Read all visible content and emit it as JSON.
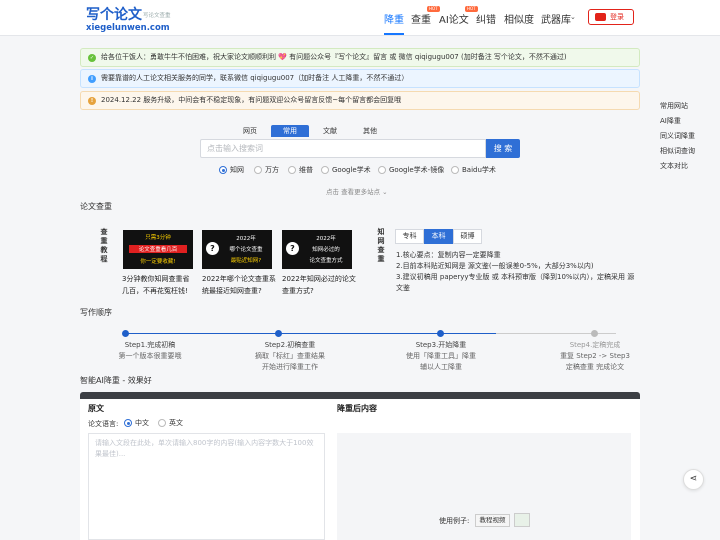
{
  "header": {
    "logo_main": "写个论文",
    "logo_sub": "写论文查重",
    "logo_domain": "xiegelunwen.com",
    "nav": [
      {
        "label": "降重",
        "active": true
      },
      {
        "label": "查重",
        "badge": "HOT"
      },
      {
        "label": "AI论文",
        "badge": "HOT"
      },
      {
        "label": "纠错"
      },
      {
        "label": "相似度"
      },
      {
        "label": "武器库"
      }
    ],
    "login_label": "登录"
  },
  "notices": [
    {
      "type": "success",
      "icon": "check-icon",
      "text": "给各位干饭人：勇敢牛牛不怕困难，祝大家论文顺顺利利 💖  有问题公众号『写个论文』留言 或 微信 qiqigugu007 (加时备注 写个论文，不然不通过)"
    },
    {
      "type": "info",
      "icon": "info-icon",
      "text": "需要靠谱的人工论文相关服务的同学，联系微信 qiqigugu007（加时备注 人工降重，不然不通过）"
    },
    {
      "type": "warning",
      "icon": "warning-icon",
      "text": "2024.12.22 服务升级，中间会有不稳定现象，有问题双迎公众号留言反馈~每个留言都会回复哦"
    }
  ],
  "right_links": [
    "常用网站",
    "AI降重",
    "同义词降重",
    "相似词查询",
    "文本对比"
  ],
  "search": {
    "tabs": [
      "网页",
      "常用",
      "文献",
      "其他"
    ],
    "active_tab": "常用",
    "placeholder": "点击输入搜索词",
    "button": "搜 索",
    "engines": [
      "知网",
      "万方",
      "维普",
      "Google学术",
      "Google学术-镜像",
      "Baidu学术"
    ],
    "selected_engine": "知网",
    "more": "点击 查看更多站点 ⌄"
  },
  "paper_check": {
    "title": "论文查重",
    "tutorial_label": "查重教程",
    "videos": [
      {
        "thumb_lines": [
          "只需3分钟",
          "论文查重看几百",
          "你一定要收藏!"
        ],
        "caption": "3分钟教你知网查重省几百，不再花冤枉钱!"
      },
      {
        "thumb_lines": [
          "2022年",
          "哪个论文查重",
          "最贴近知网?"
        ],
        "caption": "2022年哪个论文查重系统最接近知网查重?"
      },
      {
        "thumb_lines": [
          "2022年",
          "知网必过的",
          "论文查重方式"
        ],
        "caption": "2022年知网必过的论文查重方式?"
      }
    ],
    "cnki_label": "知网查重",
    "degree_tabs": [
      "专科",
      "本科",
      "硕博"
    ],
    "active_degree": "本科",
    "points": [
      "1.核心要点：复制内容一定要降重",
      "2.目前本科贴近知网是 源文鉴(一般误差0-5%，大部分3%以内)",
      "3.建议初稿用 paperyy专业版 或 本科预审版（降到10%以内），定稿采用 源文鉴"
    ]
  },
  "writing_order": {
    "title": "写作顺序",
    "steps": [
      {
        "title": "Step1.完成初稿",
        "desc": [
          "第一个版本很重要哦"
        ]
      },
      {
        "title": "Step2.初稿查重",
        "desc": [
          "摘取「标红」查重结果",
          "开始进行降重工作"
        ]
      },
      {
        "title": "Step3.开始降重",
        "desc": [
          "使用「降重工具」降重",
          "辅以人工降重"
        ]
      },
      {
        "title": "Step4.定稿完成",
        "desc": [
          "重复 Step2 -> Step3",
          "定稿查重 完成论文"
        ]
      }
    ]
  },
  "ai_rewrite": {
    "title": "智能AI降重 - 效果好",
    "original_label": "原文",
    "result_label": "降重后内容",
    "lang_label": "论文语言:",
    "langs": [
      "中文",
      "英文"
    ],
    "selected_lang": "中文",
    "textarea_placeholder": "请输入文段在此处，单次请输入800字的内容(输入内容字数大于100效果最佳)...",
    "example_label": "使用例子:",
    "example_button": "教程视频"
  },
  "colors": {
    "brand_blue": "#1f5fc9",
    "link_blue": "#1677ff",
    "login_red": "#e2231a",
    "hot_badge": "#ff6a3d"
  }
}
